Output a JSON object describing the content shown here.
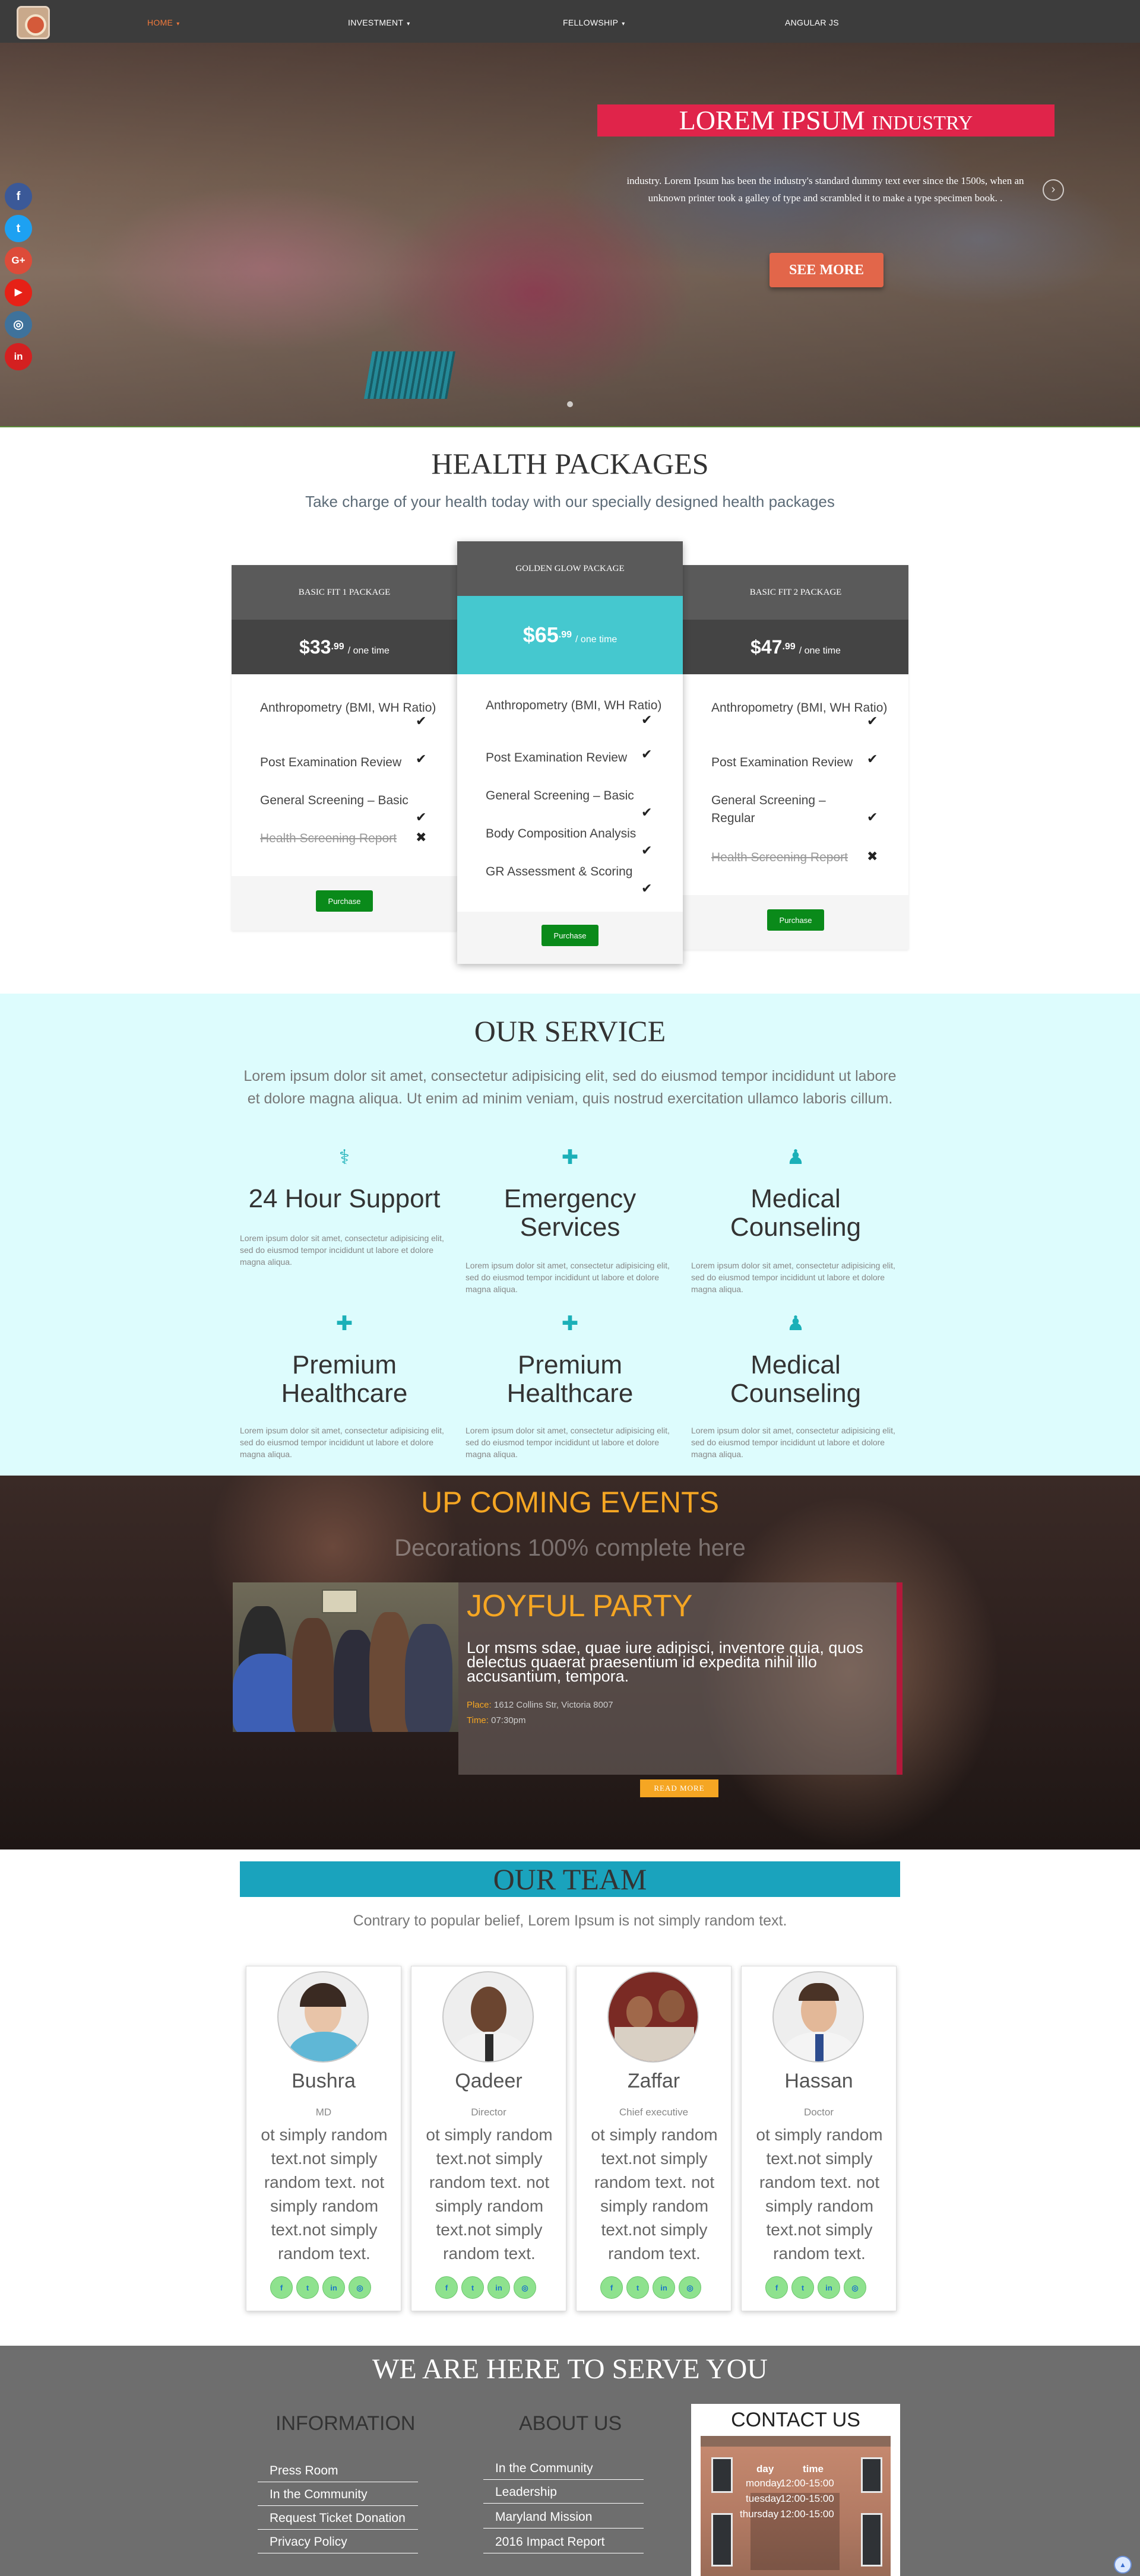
{
  "nav": {
    "items": [
      {
        "label": "HOME"
      },
      {
        "label": "INVESTMENT"
      },
      {
        "label": "FELLOWSHIP"
      },
      {
        "label": "ANGULAR JS"
      }
    ],
    "caret": "▾",
    "accent_color": "#f07a3c"
  },
  "hero": {
    "title_main": "LOREM IPSUM",
    "title_small": "INDUSTRY",
    "text": "industry. Lorem Ipsum has been the industry's standard dummy text ever since the 1500s, when an unknown printer took a galley of type and scrambled it to make a type specimen book. .",
    "button": "SEE MORE",
    "title_bg": "#e0244a"
  },
  "social": [
    {
      "icon": "facebook-icon",
      "glyph": "f",
      "color": "#3b5998"
    },
    {
      "icon": "twitter-icon",
      "glyph": "t",
      "color": "#1da1f2"
    },
    {
      "icon": "google-plus-icon",
      "glyph": "G+",
      "color": "#dd4b39"
    },
    {
      "icon": "youtube-icon",
      "glyph": "▶",
      "color": "#e62117"
    },
    {
      "icon": "instagram-icon",
      "glyph": "◎",
      "color": "#3f729b"
    },
    {
      "icon": "linkedin-icon",
      "glyph": "in",
      "color": "#d42020"
    }
  ],
  "packages": {
    "title": "HEALTH PACKAGES",
    "subtitle": "Take charge of your health today with our specially designed health packages",
    "cards": [
      {
        "name": "BASIC FIT 1 PACKAGE",
        "price": "$33",
        "cents": ".99",
        "per": "/ one time",
        "features": [
          {
            "text": "Anthropometry (BMI, WH Ratio)",
            "ok": true
          },
          {
            "text": "Post Examination Review",
            "ok": true
          },
          {
            "text": "General Screening – Basic",
            "ok": true
          },
          {
            "text": "Health Screening Report",
            "ok": false
          }
        ],
        "button": "Purchase"
      },
      {
        "name": "GOLDEN GLOW PACKAGE",
        "price": "$65",
        "cents": ".99",
        "per": "/ one time",
        "features": [
          {
            "text": "Anthropometry (BMI, WH Ratio)",
            "ok": true
          },
          {
            "text": "Post Examination Review",
            "ok": true
          },
          {
            "text": "General Screening – Basic",
            "ok": true
          },
          {
            "text": "Body Composition Analysis",
            "ok": true
          },
          {
            "text": "GR Assessment & Scoring",
            "ok": true
          }
        ],
        "button": "Purchase"
      },
      {
        "name": "BASIC FIT 2 PACKAGE",
        "price": "$47",
        "cents": ".99",
        "per": "/ one time",
        "features": [
          {
            "text": "Anthropometry (BMI, WH Ratio)",
            "ok": true
          },
          {
            "text": "Post Examination Review",
            "ok": true
          },
          {
            "text": "General Screening – Regular",
            "ok": true
          },
          {
            "text": "Health Screening Report",
            "ok": false
          }
        ],
        "button": "Purchase"
      }
    ],
    "check": "✔",
    "cross": "✖",
    "featured_color": "#45c8cf",
    "button_color": "#0a8a1a"
  },
  "service": {
    "title": "OUR SERVICE",
    "lead": "Lorem ipsum dolor sit amet, consectetur adipisicing elit, sed do eiusmod tempor incididunt ut labore et dolore magna aliqua. Ut enim ad minim veniam, quis nostrud exercitation ullamco laboris cillum.",
    "items": [
      {
        "icon": "stethoscope-icon",
        "glyph": "⚕",
        "title": "24 Hour Support",
        "text": "Lorem ipsum dolor sit amet, consectetur adipisicing elit, sed do eiusmod tempor incididunt ut labore et dolore magna aliqua."
      },
      {
        "icon": "ambulance-icon",
        "glyph": "✚",
        "title": "Emergency Services",
        "text": "Lorem ipsum dolor sit amet, consectetur adipisicing elit, sed do eiusmod tempor incididunt ut labore et dolore magna aliqua."
      },
      {
        "icon": "doctor-icon",
        "glyph": "♟",
        "title": "Medical Counseling",
        "text": "Lorem ipsum dolor sit amet, consectetur adipisicing elit, sed do eiusmod tempor incididunt ut labore et dolore magna aliqua."
      },
      {
        "icon": "medkit-icon",
        "glyph": "✚",
        "title": "Premium Healthcare",
        "text": "Lorem ipsum dolor sit amet, consectetur adipisicing elit, sed do eiusmod tempor incididunt ut labore et dolore magna aliqua."
      },
      {
        "icon": "medkit-icon",
        "glyph": "✚",
        "title": "Premium Healthcare",
        "text": "Lorem ipsum dolor sit amet, consectetur adipisicing elit, sed do eiusmod tempor incididunt ut labore et dolore magna aliqua."
      },
      {
        "icon": "doctor-icon",
        "glyph": "♟",
        "title": "Medical Counseling",
        "text": "Lorem ipsum dolor sit amet, consectetur adipisicing elit, sed do eiusmod tempor incididunt ut labore et dolore magna aliqua."
      }
    ],
    "bg": "#ddfcfd",
    "icon_color": "#1bb0b8"
  },
  "events": {
    "title": "UP COMING EVENTS",
    "subtitle": "Decorations 100% complete here",
    "name": "JOYFUL PARTY",
    "desc": "Lor msms sdae, quae iure adipisci, inventore quia, quos delectus quaerat praesentium id expedita nihil illo accusantium, tempora.",
    "place_label": "Place:",
    "place": "1612 Collins Str, Victoria 8007",
    "time_label": "Time:",
    "time": "07:30pm",
    "button": "READ MORE",
    "accent": "#f5a623"
  },
  "team": {
    "title": "OUR TEAM",
    "subtitle": "Contrary to popular belief, Lorem Ipsum is not simply random text.",
    "members": [
      {
        "name": "Bushra",
        "role": "MD",
        "bio": "ot simply random text.not simply random text. not simply random text.not simply random text."
      },
      {
        "name": "Qadeer",
        "role": "Director",
        "bio": "ot simply random text.not simply random text. not simply random text.not simply random text."
      },
      {
        "name": "Zaffar",
        "role": "Chief executive",
        "bio": "ot simply random text.not simply random text. not simply random text.not simply random text."
      },
      {
        "name": "Hassan",
        "role": "Doctor",
        "bio": "ot simply random text.not simply random text. not simply random text.not simply random text."
      }
    ],
    "social": [
      "f",
      "t",
      "in",
      "◎"
    ],
    "bar_color": "#1aa3bd"
  },
  "footer": {
    "title": "WE ARE HERE TO SERVE YOU",
    "info_title": "INFORMATION",
    "info_links": [
      "Press Room",
      "In the Community",
      "Request Ticket Donation",
      "Privacy Policy"
    ],
    "about_title": "ABOUT US",
    "about_links": [
      "In the Community",
      "Leadership",
      "Maryland Mission",
      "2016 Impact Report"
    ],
    "contact_title": "CONTACT US",
    "contact_cols": [
      "day",
      "time"
    ],
    "contact_rows": [
      {
        "day": "monday",
        "time": "12:00-15:00"
      },
      {
        "day": "tuesday",
        "time": "12:00-15:00"
      },
      {
        "day": "thursday",
        "time": "12:00-15:00"
      }
    ]
  }
}
